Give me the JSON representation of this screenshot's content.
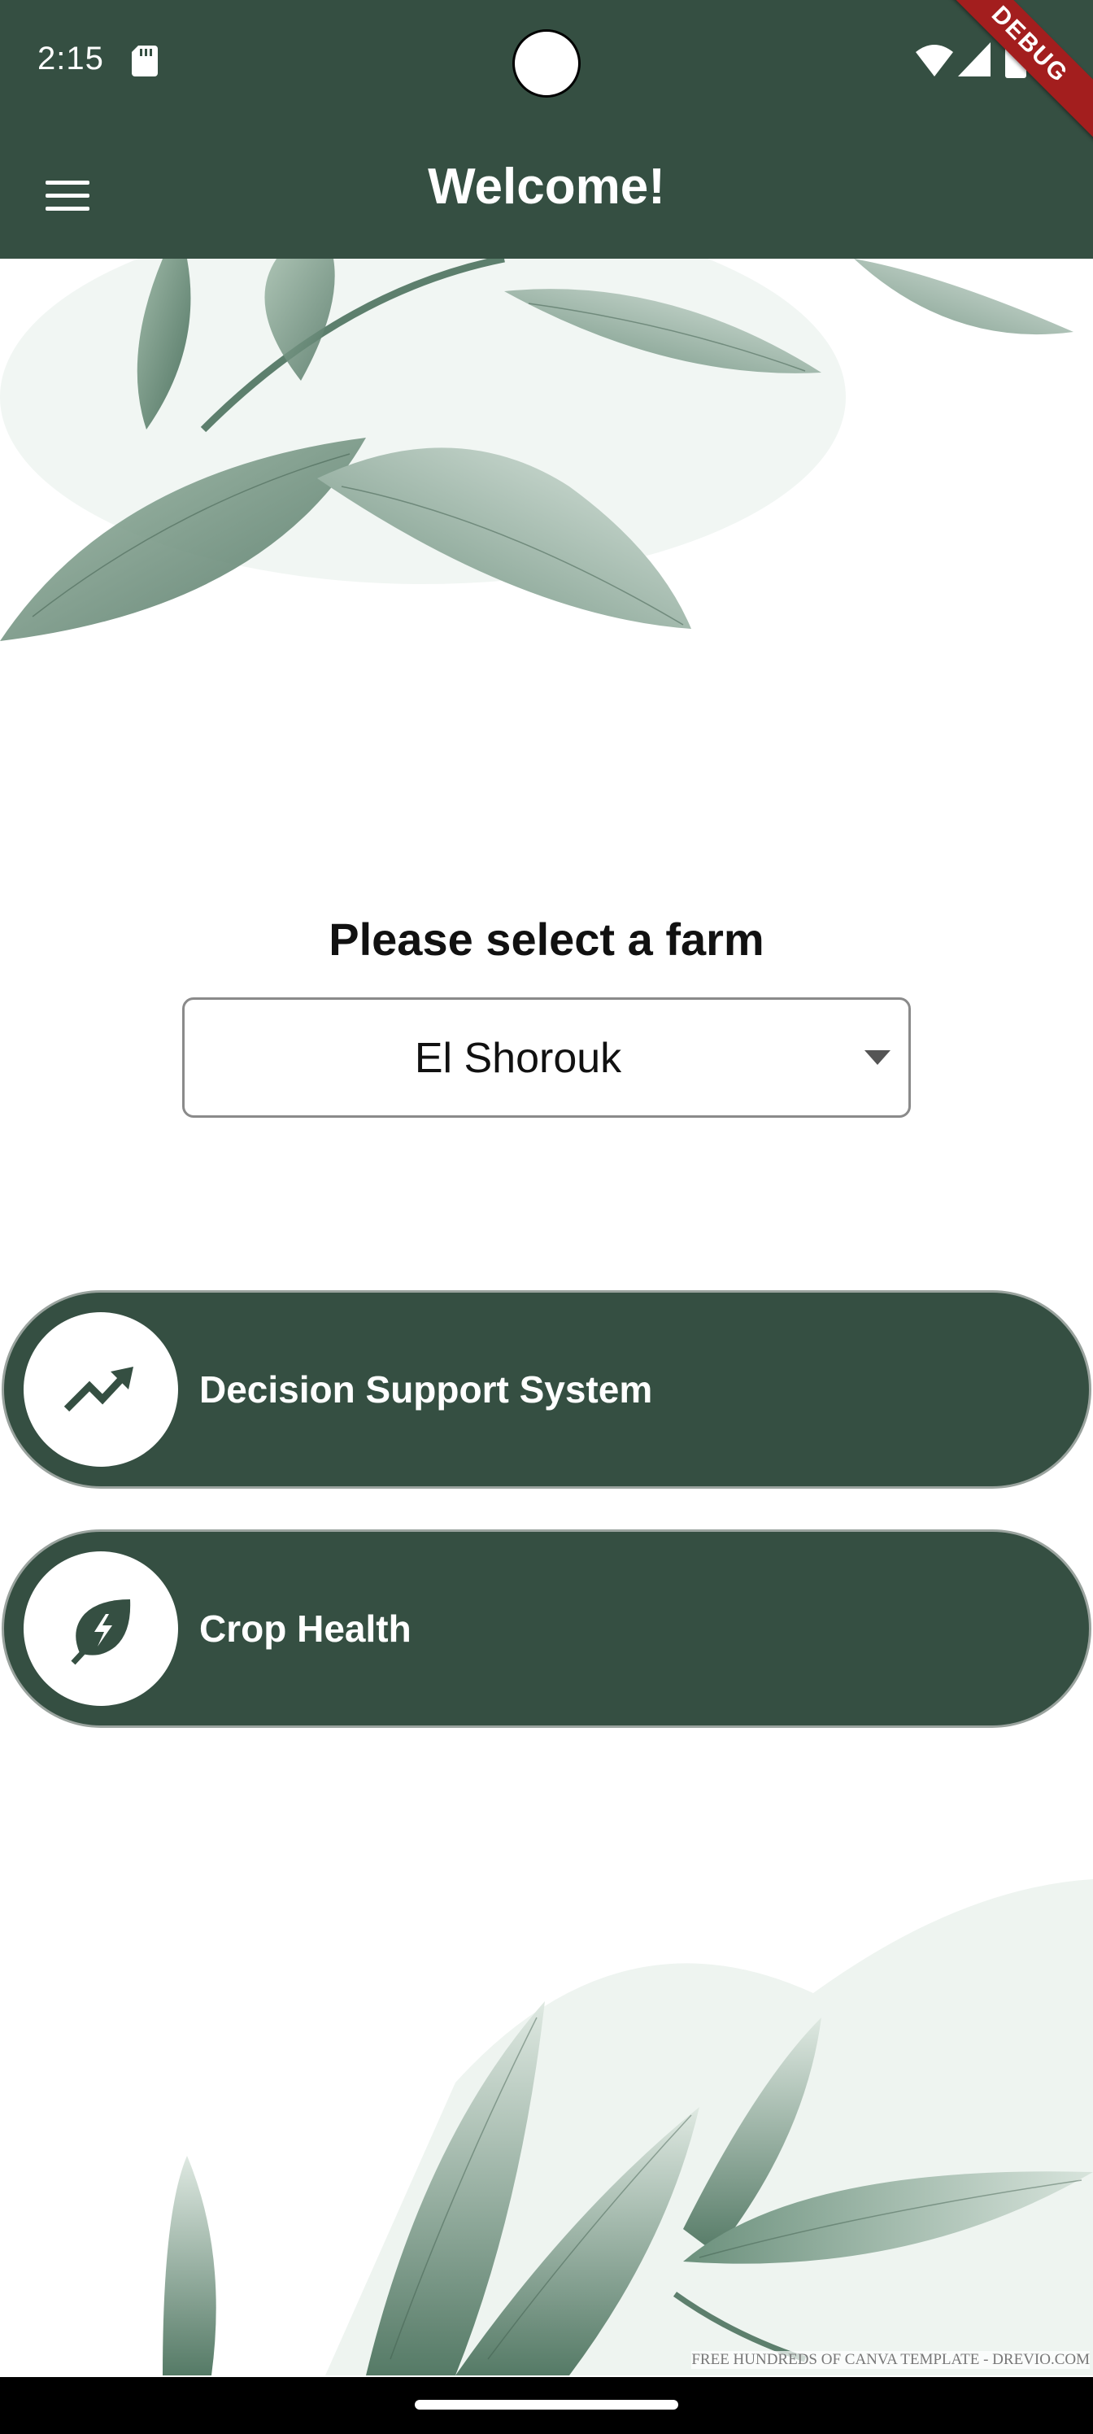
{
  "status_bar": {
    "time": "2:15",
    "icons": [
      "sd-card-icon",
      "wifi-icon",
      "signal-icon",
      "battery-icon"
    ]
  },
  "debug_banner": "DEBUG",
  "app_bar": {
    "title": "Welcome!",
    "menu_icon": "menu-icon",
    "background_color": "#354f42"
  },
  "farm_selector": {
    "label": "Please select a farm",
    "selected_value": "El Shorouk"
  },
  "actions": [
    {
      "label": "Decision Support System",
      "icon": "trending-up-icon"
    },
    {
      "label": "Crop Health",
      "icon": "eco-leaf-icon"
    }
  ],
  "watermark": "FREE HUNDREDS OF CANVA TEMPLATE - DREVIO.COM",
  "colors": {
    "primary": "#354f42",
    "on_primary": "#ffffff",
    "leaf": "#7f9f8c"
  }
}
